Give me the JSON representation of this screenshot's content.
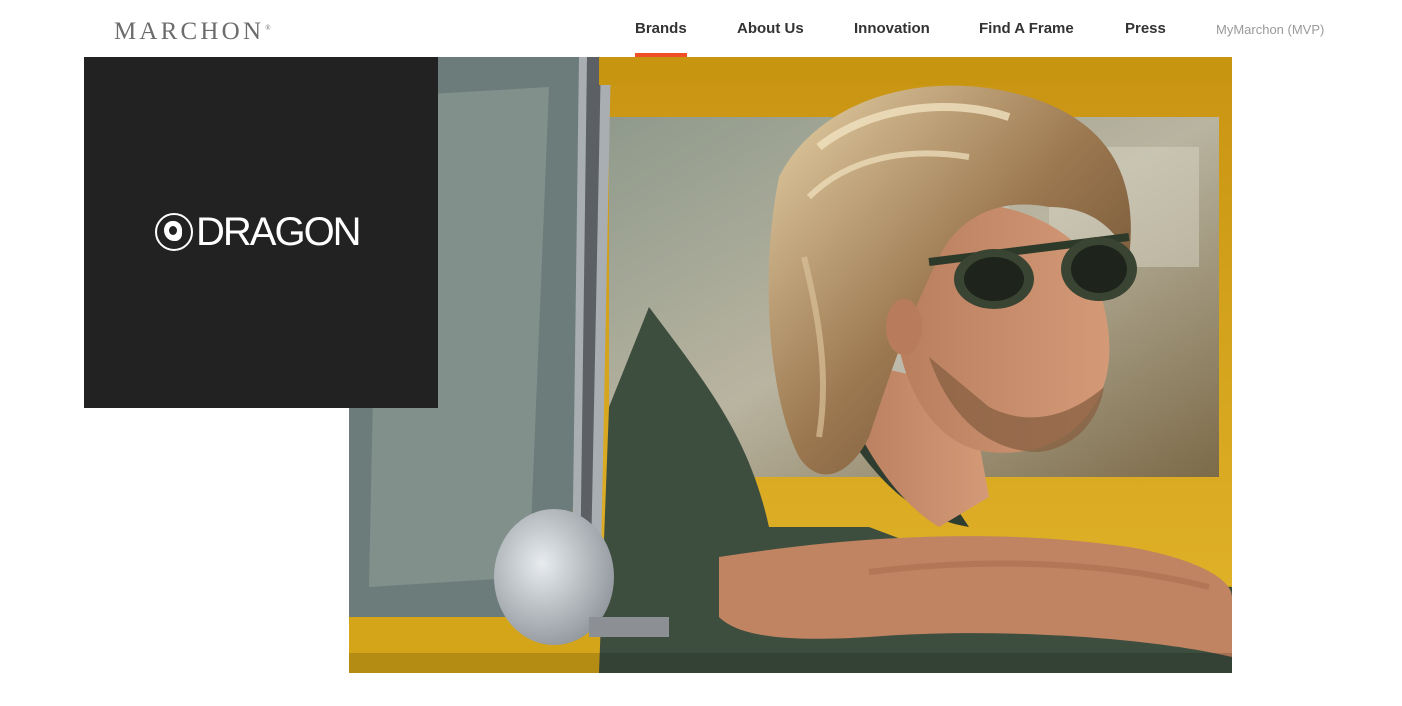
{
  "header": {
    "logo_text": "MARCHON",
    "nav": {
      "brands": "Brands",
      "about": "About Us",
      "innovation": "Innovation",
      "find_frame": "Find A Frame",
      "press": "Press",
      "mymarchon": "MyMarchon (MVP)"
    },
    "active_nav": "Brands"
  },
  "hero": {
    "brand_name": "DRAGON",
    "brand_icon": "dragon-emblem-icon",
    "photo_subject": "man-in-sunglasses-in-yellow-car-photo"
  },
  "colors": {
    "accent": "#f04e23",
    "panel": "#222222",
    "car_yellow": "#d9a81f",
    "nav_text": "#333333",
    "logo_gray": "#6c6c6c"
  }
}
